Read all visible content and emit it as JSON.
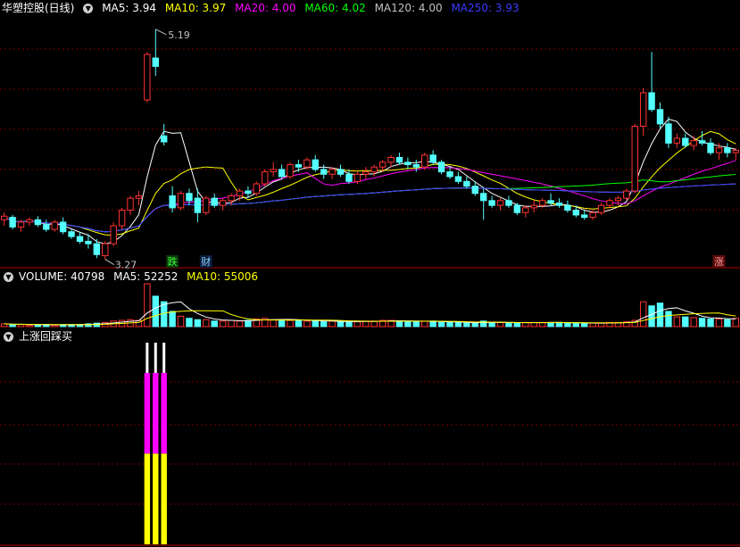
{
  "main": {
    "title": "华塑控股(日线)",
    "ma": [
      {
        "label": "MA5: 3.94",
        "color": "#ffffff"
      },
      {
        "label": "MA10: 3.97",
        "color": "#ffff00"
      },
      {
        "label": "MA20: 4.00",
        "color": "#ff00ff"
      },
      {
        "label": "MA60: 4.02",
        "color": "#00ff00"
      },
      {
        "label": "MA120: 4.00",
        "color": "#c0c0c0"
      },
      {
        "label": "MA250: 3.93",
        "color": "#3a3aff"
      }
    ],
    "high_label": "5.19",
    "low_label": "3.27",
    "markers": [
      {
        "text": "跌",
        "color": "#3cff3c",
        "bg": "#0b3b0b"
      },
      {
        "text": "财",
        "color": "#8ad0ff",
        "bg": "#0b1b3b"
      },
      {
        "text": "涨",
        "color": "#ff9a9a",
        "bg": "#5a0a0a"
      }
    ]
  },
  "volume": {
    "title": "VOLUME: 40798",
    "ma5": "MA5: 52252",
    "ma10": "MA10: 55006"
  },
  "indicator": {
    "title": "上涨回踩买"
  },
  "colors": {
    "up": "#ff3232",
    "down": "#54ffff",
    "grid": "#7a0000",
    "border": "#b00000"
  },
  "chart_data": {
    "type": "candlestick",
    "price_range": [
      3.2,
      5.3
    ],
    "candles": [
      [
        3.6,
        3.66,
        3.55,
        3.63
      ],
      [
        3.62,
        3.64,
        3.52,
        3.54
      ],
      [
        3.54,
        3.6,
        3.5,
        3.58
      ],
      [
        3.58,
        3.62,
        3.55,
        3.6
      ],
      [
        3.6,
        3.63,
        3.54,
        3.56
      ],
      [
        3.56,
        3.6,
        3.5,
        3.52
      ],
      [
        3.52,
        3.6,
        3.5,
        3.58
      ],
      [
        3.58,
        3.62,
        3.48,
        3.5
      ],
      [
        3.5,
        3.52,
        3.44,
        3.46
      ],
      [
        3.46,
        3.5,
        3.4,
        3.42
      ],
      [
        3.42,
        3.48,
        3.36,
        3.4
      ],
      [
        3.4,
        3.44,
        3.28,
        3.31
      ],
      [
        3.3,
        3.42,
        3.27,
        3.4
      ],
      [
        3.4,
        3.58,
        3.38,
        3.55
      ],
      [
        3.55,
        3.7,
        3.52,
        3.68
      ],
      [
        3.68,
        3.8,
        3.64,
        3.78
      ],
      [
        3.78,
        3.84,
        3.72,
        3.8
      ],
      [
        4.6,
        5.0,
        4.58,
        4.98
      ],
      [
        4.95,
        5.19,
        4.8,
        4.88
      ],
      [
        4.3,
        4.4,
        4.22,
        4.25
      ],
      [
        3.8,
        3.88,
        3.66,
        3.7
      ],
      [
        3.7,
        3.84,
        3.68,
        3.82
      ],
      [
        3.82,
        3.86,
        3.72,
        3.76
      ],
      [
        3.78,
        3.86,
        3.58,
        3.66
      ],
      [
        3.66,
        3.8,
        3.64,
        3.78
      ],
      [
        3.78,
        3.82,
        3.7,
        3.72
      ],
      [
        3.72,
        3.78,
        3.68,
        3.76
      ],
      [
        3.76,
        3.82,
        3.72,
        3.8
      ],
      [
        3.8,
        3.86,
        3.76,
        3.84
      ],
      [
        3.84,
        3.88,
        3.78,
        3.82
      ],
      [
        3.82,
        3.92,
        3.8,
        3.9
      ],
      [
        3.9,
        4.02,
        3.88,
        4.0
      ],
      [
        4.0,
        4.08,
        3.96,
        4.02
      ],
      [
        4.02,
        4.06,
        3.94,
        3.96
      ],
      [
        3.96,
        4.08,
        3.94,
        4.06
      ],
      [
        4.06,
        4.1,
        4.0,
        4.04
      ],
      [
        4.04,
        4.12,
        4.02,
        4.1
      ],
      [
        4.1,
        4.14,
        4.0,
        4.02
      ],
      [
        4.02,
        4.06,
        3.94,
        3.98
      ],
      [
        3.98,
        4.04,
        3.94,
        4.02
      ],
      [
        4.02,
        4.06,
        3.96,
        3.98
      ],
      [
        3.98,
        4.02,
        3.9,
        3.92
      ],
      [
        3.92,
        4.0,
        3.9,
        3.98
      ],
      [
        3.98,
        4.04,
        3.94,
        4.0
      ],
      [
        4.0,
        4.06,
        3.96,
        4.04
      ],
      [
        4.04,
        4.1,
        4.0,
        4.08
      ],
      [
        4.08,
        4.14,
        4.04,
        4.12
      ],
      [
        4.12,
        4.16,
        4.06,
        4.08
      ],
      [
        4.08,
        4.12,
        4.02,
        4.06
      ],
      [
        4.06,
        4.1,
        4.0,
        4.04
      ],
      [
        4.04,
        4.16,
        4.02,
        4.14
      ],
      [
        4.14,
        4.18,
        4.06,
        4.08
      ],
      [
        4.08,
        4.1,
        3.98,
        4.0
      ],
      [
        4.0,
        4.04,
        3.94,
        3.96
      ],
      [
        3.96,
        4.0,
        3.9,
        3.92
      ],
      [
        3.92,
        3.96,
        3.86,
        3.88
      ],
      [
        3.88,
        3.92,
        3.8,
        3.82
      ],
      [
        3.82,
        3.86,
        3.6,
        3.76
      ],
      [
        3.76,
        3.8,
        3.7,
        3.72
      ],
      [
        3.72,
        3.78,
        3.68,
        3.76
      ],
      [
        3.76,
        3.8,
        3.7,
        3.72
      ],
      [
        3.72,
        3.74,
        3.64,
        3.66
      ],
      [
        3.66,
        3.72,
        3.62,
        3.7
      ],
      [
        3.7,
        3.76,
        3.66,
        3.72
      ],
      [
        3.72,
        3.78,
        3.7,
        3.76
      ],
      [
        3.76,
        3.82,
        3.72,
        3.74
      ],
      [
        3.74,
        3.78,
        3.7,
        3.72
      ],
      [
        3.72,
        3.76,
        3.66,
        3.68
      ],
      [
        3.68,
        3.72,
        3.62,
        3.64
      ],
      [
        3.64,
        3.68,
        3.6,
        3.62
      ],
      [
        3.62,
        3.68,
        3.6,
        3.66
      ],
      [
        3.66,
        3.74,
        3.64,
        3.72
      ],
      [
        3.72,
        3.78,
        3.7,
        3.76
      ],
      [
        3.76,
        3.8,
        3.72,
        3.78
      ],
      [
        3.78,
        3.86,
        3.76,
        3.84
      ],
      [
        3.84,
        4.4,
        3.82,
        4.38
      ],
      [
        4.38,
        4.7,
        4.3,
        4.66
      ],
      [
        4.66,
        5.0,
        4.5,
        4.52
      ],
      [
        4.52,
        4.58,
        4.36,
        4.4
      ],
      [
        4.4,
        4.46,
        4.2,
        4.24
      ],
      [
        4.24,
        4.32,
        4.2,
        4.28
      ],
      [
        4.28,
        4.32,
        4.2,
        4.22
      ],
      [
        4.22,
        4.3,
        4.18,
        4.26
      ],
      [
        4.26,
        4.34,
        4.22,
        4.24
      ],
      [
        4.24,
        4.28,
        4.14,
        4.16
      ],
      [
        4.16,
        4.24,
        4.1,
        4.2
      ],
      [
        4.2,
        4.24,
        4.12,
        4.16
      ],
      [
        4.16,
        4.2,
        4.1,
        4.18
      ]
    ],
    "volumes": [
      4,
      3,
      3,
      2,
      3,
      3,
      2,
      3,
      3,
      3,
      4,
      5,
      6,
      8,
      9,
      10,
      9,
      62,
      44,
      36,
      22,
      15,
      12,
      10,
      10,
      8,
      8,
      9,
      8,
      9,
      11,
      12,
      10,
      10,
      9,
      9,
      8,
      8,
      7,
      8,
      7,
      7,
      7,
      8,
      8,
      9,
      9,
      8,
      7,
      7,
      8,
      8,
      6,
      6,
      6,
      5,
      5,
      8,
      6,
      6,
      5,
      5,
      6,
      6,
      6,
      6,
      6,
      5,
      5,
      5,
      5,
      5,
      6,
      6,
      7,
      9,
      36,
      30,
      34,
      22,
      14,
      14,
      13,
      12,
      11,
      11,
      10,
      12
    ],
    "indicator_bars": [
      {
        "index": 17,
        "yellow": 0.45,
        "magenta": 0.4,
        "white": 0.15
      },
      {
        "index": 18,
        "yellow": 0.45,
        "magenta": 0.4,
        "white": 0.15
      },
      {
        "index": 19,
        "yellow": 0.45,
        "magenta": 0.4,
        "white": 0.15
      }
    ]
  }
}
